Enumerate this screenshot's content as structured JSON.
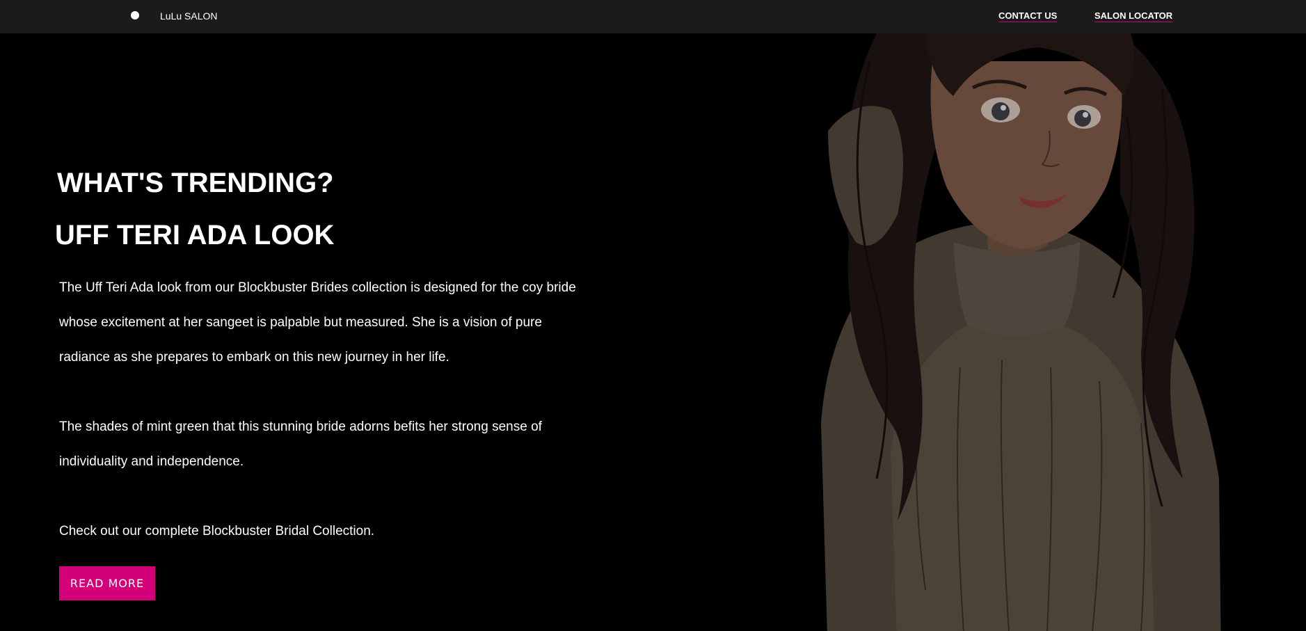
{
  "nav": {
    "brand": "LuLu SALON",
    "links": [
      "CONTACT US",
      "SALON LOCATOR"
    ]
  },
  "hero": {
    "heading_1": "WHAT'S TRENDING?",
    "heading_2": "UFF TERI ADA LOOK",
    "paragraphs": [
      "The Uff Teri Ada look from our Blockbuster Brides collection is designed for the coy bride whose excitement at her sangeet is palpable but measured. She is a vision of pure radiance as she prepares to embark on this new journey in her life.",
      "The shades of mint green that this stunning bride adorns befits her strong sense of individuality and independence.",
      "Check out our complete Blockbuster Bridal Collection."
    ],
    "button_label": "READ MORE"
  },
  "colors": {
    "navbar_bg": "#1b1b1b",
    "page_bg": "#000000",
    "accent": "#d4007a"
  }
}
